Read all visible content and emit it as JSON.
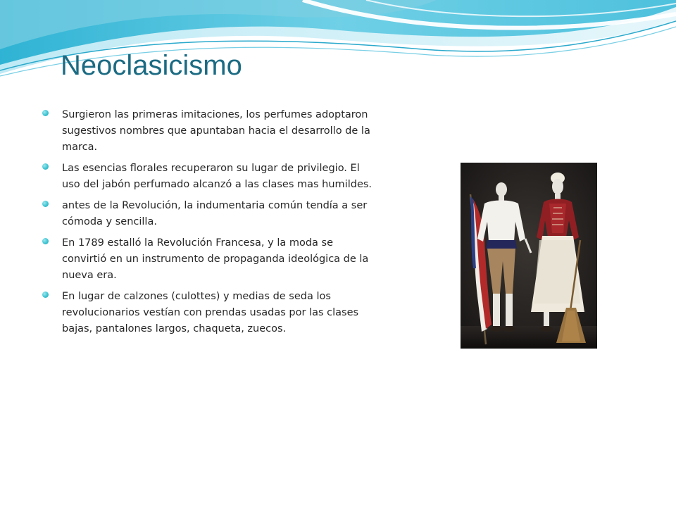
{
  "slide": {
    "title": "Neoclasicismo",
    "bullets": [
      "Surgieron las primeras imitaciones, los perfumes adoptaron sugestivos nombres que apuntaban hacia el desarrollo de la marca.",
      "Las esencias florales recuperaron su lugar de privilegio. El uso del jabón perfumado alcanzó a las clases mas humildes.",
      "antes de la Revolución, la indumentaria común tendía a ser cómoda y sencilla.",
      "En 1789 estalló la Revolución Francesa, y la moda se convirtió en un instrumento de propaganda ideológica de la nueva era.",
      "En lugar de calzones (culottes) y medias de seda los revolucionarios vestían con prendas usadas por las clases bajas, pantalones largos, chaqueta, zuecos."
    ]
  },
  "theme": {
    "title_color": "#1b6b83",
    "bullet_color": "#3fc3d1",
    "wave_colors": [
      "#2fb8d6",
      "#8fd9ea",
      "#cdeff7"
    ]
  }
}
